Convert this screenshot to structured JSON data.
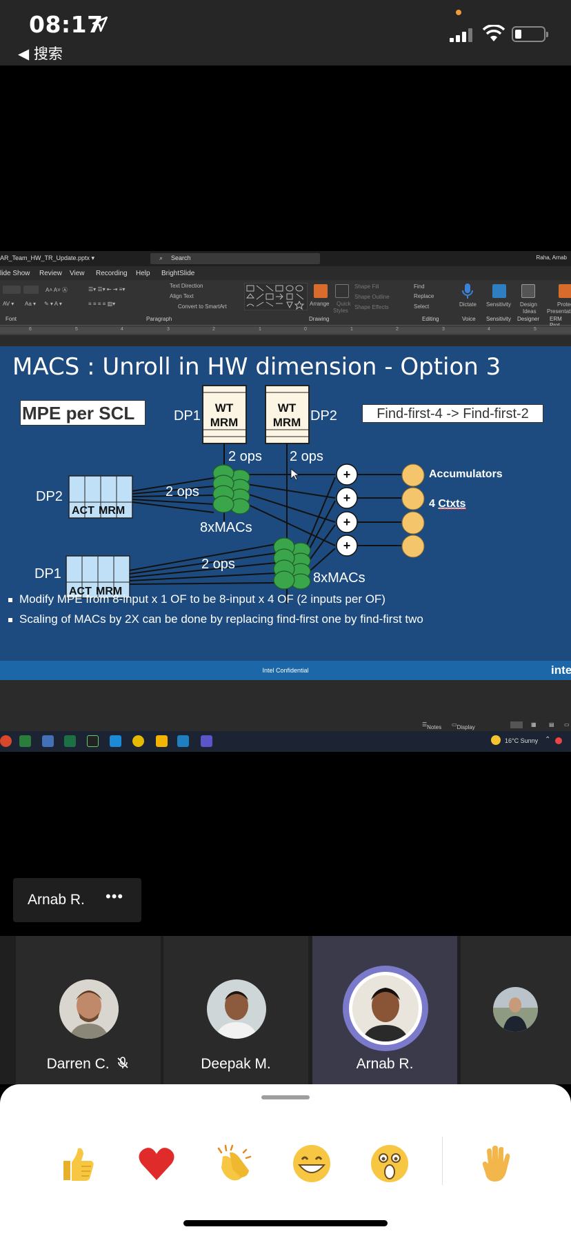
{
  "status_bar": {
    "time": "08:17",
    "back_label": "◀ 搜索"
  },
  "ppt": {
    "file_name": "AR_Team_HW_TR_Update.pptx ▾",
    "search_placeholder": "Search",
    "user": "Raha, Arnab",
    "menu": [
      "lide Show",
      "Review",
      "View",
      "Recording",
      "Help",
      "BrightSlide"
    ],
    "ribbon_groups": [
      "Font",
      "Paragraph",
      "Drawing",
      "Editing",
      "Voice",
      "Sensitivity",
      "Designer",
      "ERM Prot"
    ],
    "ribbon_labels": {
      "find": "Find",
      "replace": "Replace",
      "select": "Select",
      "dictate": "Dictate",
      "sensitivity": "Sensitivity",
      "design_ideas_1": "Design",
      "design_ideas_2": "Ideas",
      "protect": "Protec",
      "protect_2": "Presentatio",
      "arrange": "Arrange",
      "quick_styles": "Quick",
      "quick_styles_2": "Styles",
      "shape_fill": "Shape Fill",
      "shape_outline": "Shape Outline",
      "shape_effects": "Shape Effects",
      "text_direction": "Text Direction",
      "align_text": "Align Text",
      "convert_smartart": "Convert to SmartArt"
    },
    "ruler_marks": [
      "6",
      "5",
      "4",
      "3",
      "2",
      "1",
      "0",
      "1",
      "2",
      "3",
      "4",
      "5"
    ],
    "status": {
      "notes": "Notes",
      "display_settings": "Display Settings"
    },
    "taskbar_weather": "16°C Sunny"
  },
  "slide": {
    "title": "MACS : Unroll in HW dimension - Option 3",
    "mpe_label": "MPE per SCL",
    "find_first_label": "Find-first-4 -> Find-first-2",
    "labels": {
      "dp1_top": "DP1",
      "dp2_top": "DP2",
      "wt": "WT",
      "mrm": "MRM",
      "dp2_left": "DP2",
      "dp1_left": "DP1",
      "act": "ACT",
      "act_mrm": "MRM",
      "ops_a": "2 ops",
      "ops_b": "2 ops",
      "ops_c": "2 ops",
      "ops_d": "2 ops",
      "macs_a": "8xMACs",
      "macs_b": "8xMACs",
      "accumulators": "Accumulators",
      "ctxts_prefix": "4 ",
      "ctxts": "Ctxts",
      "plus": "+"
    },
    "bullets": [
      "Modify MPE from 8-input x 1 OF to be 8-input x 4 OF (2 inputs per OF)",
      "Scaling of MACs by 2X can be done by replacing find-first one by find-first two"
    ],
    "footer": "Intel Confidential",
    "footer_logo": "intel"
  },
  "meeting": {
    "speaker_tag": "Arnab R.",
    "more_label": "•••",
    "participants": [
      {
        "name": "Darren C.",
        "muted": true
      },
      {
        "name": "Deepak M.",
        "muted": false
      },
      {
        "name": "Arnab R.",
        "muted": false,
        "speaking": true
      },
      {
        "name": "",
        "muted": false
      }
    ]
  },
  "reactions": [
    "thumbs-up",
    "heart",
    "clapping-hands",
    "grinning-face",
    "surprised-face",
    "raised-hand"
  ],
  "colors": {
    "slide_bg": "#1d4b7f",
    "mac_green": "#3aa54a",
    "accumulator": "#f5c56b",
    "speaking_ring": "#7b79c9"
  }
}
